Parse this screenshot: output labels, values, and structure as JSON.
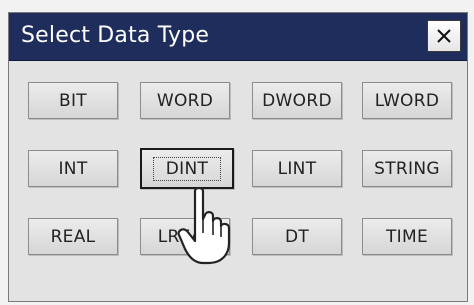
{
  "dialog": {
    "title": "Select Data Type",
    "close_label": "close"
  },
  "buttons": [
    {
      "label": "BIT"
    },
    {
      "label": "WORD"
    },
    {
      "label": "DWORD"
    },
    {
      "label": "LWORD"
    },
    {
      "label": "INT"
    },
    {
      "label": "DINT"
    },
    {
      "label": "LINT"
    },
    {
      "label": "STRING"
    },
    {
      "label": "REAL"
    },
    {
      "label": "LREAL"
    },
    {
      "label": "DT"
    },
    {
      "label": "TIME"
    }
  ],
  "selected": "DINT",
  "colors": {
    "titlebar": "#1f2d5c",
    "dialog_bg": "#e3e3e3"
  },
  "cursor": "hand-pointer-icon"
}
